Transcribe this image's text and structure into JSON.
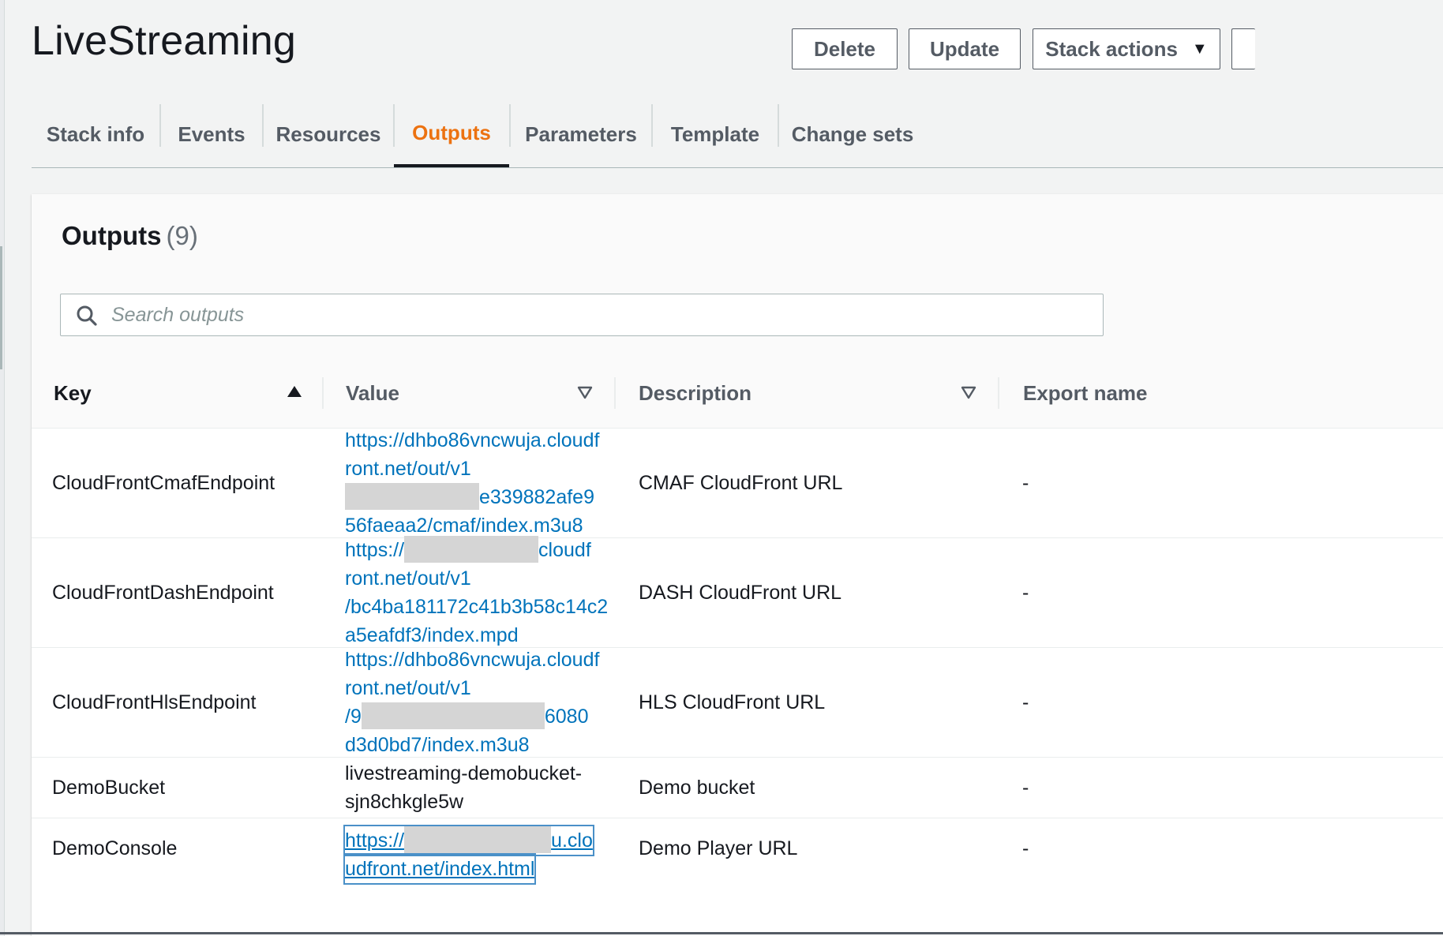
{
  "stack": {
    "title": "LiveStreaming"
  },
  "header_actions": {
    "delete": "Delete",
    "update": "Update",
    "stack_actions": "Stack actions"
  },
  "tabs": [
    {
      "label": "Stack info"
    },
    {
      "label": "Events"
    },
    {
      "label": "Resources"
    },
    {
      "label": "Outputs",
      "active": true
    },
    {
      "label": "Parameters"
    },
    {
      "label": "Template"
    },
    {
      "label": "Change sets"
    }
  ],
  "outputs": {
    "title": "Outputs",
    "count": "(9)",
    "search_placeholder": "Search outputs",
    "columns": {
      "key": "Key",
      "value": "Value",
      "description": "Description",
      "export": "Export name"
    },
    "rows": [
      {
        "key": "CloudFrontCmafEndpoint",
        "value_lines": [
          "https://dhbo86vncwuja.cloudf",
          "ront.net/out/v1",
          "e339882afe9",
          "56faeaa2/cmaf/index.m3u8"
        ],
        "description": "CMAF CloudFront URL",
        "export": "-"
      },
      {
        "key": "CloudFrontDashEndpoint",
        "value_lines": [
          "https://",
          "cloudf",
          "ront.net/out/v1",
          "/bc4ba181172c41b3b58c14c2",
          "a5eafdf3/index.mpd"
        ],
        "description": "DASH CloudFront URL",
        "export": "-"
      },
      {
        "key": "CloudFrontHlsEndpoint",
        "value_lines": [
          "https://dhbo86vncwuja.cloudf",
          "ront.net/out/v1",
          "/9",
          "6080",
          "d3d0bd7/index.m3u8"
        ],
        "description": "HLS CloudFront URL",
        "export": "-"
      },
      {
        "key": "DemoBucket",
        "value_lines": [
          "livestreaming-demobucket-",
          "sjn8chkgle5w"
        ],
        "description": "Demo bucket",
        "export": "-"
      },
      {
        "key": "DemoConsole",
        "value_lines": [
          "https://",
          "u.clo",
          "udfront.net/index.html"
        ],
        "description": "Demo Player URL",
        "export": "-"
      }
    ]
  },
  "colors": {
    "accent": "#ec7211",
    "link": "#0073bb",
    "text": "#16191f",
    "muted": "#545b64"
  },
  "icons": {
    "search": "search-icon",
    "sort_asc": "caret-up-icon",
    "sort": "caret-down-outline-icon",
    "dropdown": "caret-down-icon"
  }
}
